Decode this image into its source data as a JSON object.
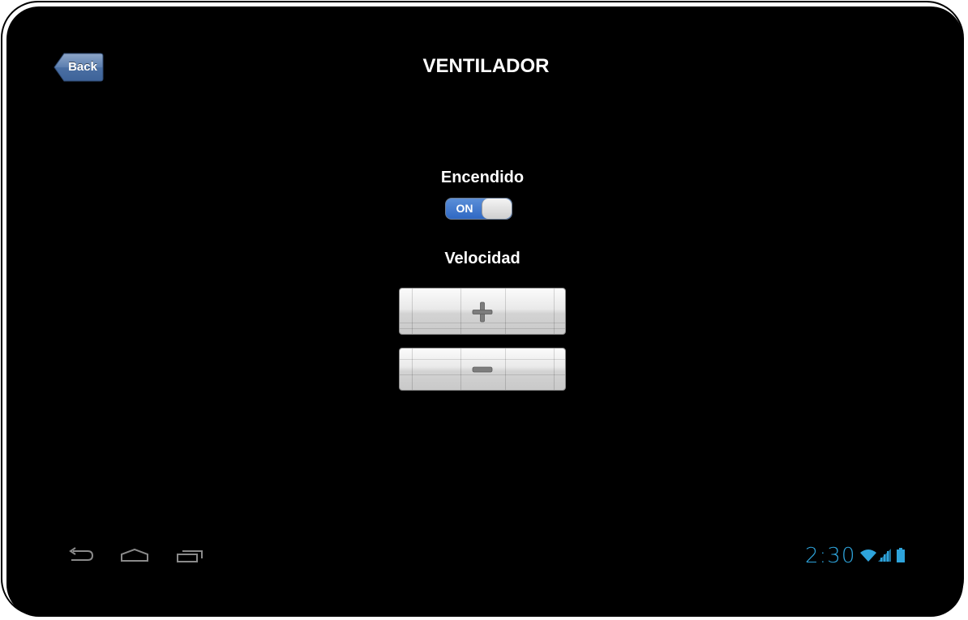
{
  "header": {
    "back_label": "Back",
    "title": "VENTILADOR"
  },
  "power": {
    "label": "Encendido",
    "toggle_state": "ON",
    "is_on": true
  },
  "speed": {
    "label": "Velocidad",
    "increase_icon": "plus-icon",
    "decrease_icon": "minus-icon"
  },
  "system_bar": {
    "nav_icons": [
      "back-arrow-icon",
      "home-icon",
      "recent-apps-icon"
    ],
    "time": "2:30",
    "status_icons": [
      "wifi-icon",
      "signal-icon",
      "battery-icon"
    ]
  },
  "colors": {
    "screen_background": "#000000",
    "toggle_on": "#2f68c3",
    "back_button": "#4d6e9e",
    "status_accent": "#2ea4dc"
  }
}
